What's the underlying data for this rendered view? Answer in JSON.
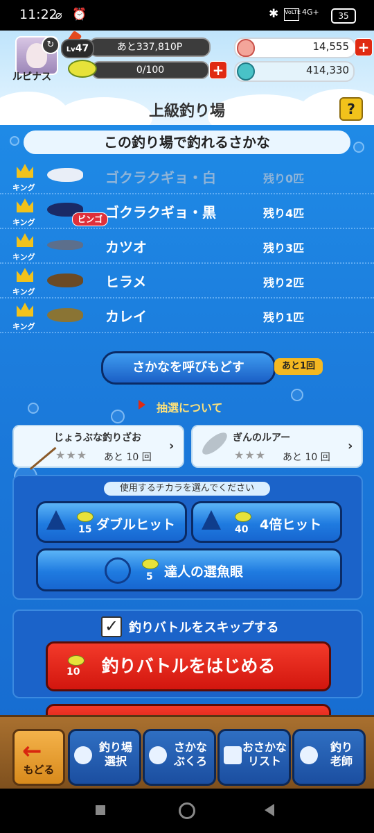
{
  "status": {
    "time": "11:22",
    "battery": "35"
  },
  "player": {
    "name": "ルピナス",
    "level_prefix": "Lv",
    "level": "47",
    "exp_text": "あと337,810P",
    "energy_text": "0/100"
  },
  "currency": {
    "gems": "14,555",
    "coins": "414,330"
  },
  "page": {
    "title": "上級釣り場",
    "help": "?"
  },
  "fish_list": {
    "header": "この釣り場で釣れるさかな",
    "rank_label": "キング",
    "items": [
      {
        "name": "ゴクラクギョ・白",
        "remaining": "残り0匹",
        "color": "#e9eef7"
      },
      {
        "name": "ゴクラクギョ・黒",
        "remaining": "残り4匹",
        "color": "#1a2a66"
      },
      {
        "name": "カツオ",
        "remaining": "残り3匹",
        "color": "#5c6f8c"
      },
      {
        "name": "ヒラメ",
        "remaining": "残り2匹",
        "color": "#6b4a24"
      },
      {
        "name": "カレイ",
        "remaining": "残り1匹",
        "color": "#8a7434"
      }
    ],
    "bingo_tag": "ビンゴ"
  },
  "recall": {
    "label": "さかなを呼びもどす",
    "remaining": "あと1回"
  },
  "lottery_link": "抽選について",
  "items": [
    {
      "name": "じょうぶな釣りざお",
      "count_text": "あと 10 回"
    },
    {
      "name": "ぎんのルアー",
      "count_text": "あと 10 回"
    }
  ],
  "skills": {
    "hint": "使用するチカラを選んでください",
    "buttons": [
      {
        "label": "ダブルヒット",
        "cost": "15"
      },
      {
        "label": "4倍ヒット",
        "cost": "40"
      },
      {
        "label": "達人の選魚眼",
        "cost": "5"
      }
    ]
  },
  "battle": {
    "skip_label": "釣りバトルをスキップする",
    "start_label": "釣りバトルをはじめる",
    "start_cost": "10"
  },
  "bottom_nav": {
    "back": "もどる",
    "items": [
      "釣り場\n選択",
      "さかな\nぶくろ",
      "おさかな\nリスト",
      "釣り\n老師"
    ]
  },
  "colors": {
    "main_blue": "#1a76d8",
    "start_red": "#e0200f",
    "accent_yellow": "#f2c21b"
  }
}
